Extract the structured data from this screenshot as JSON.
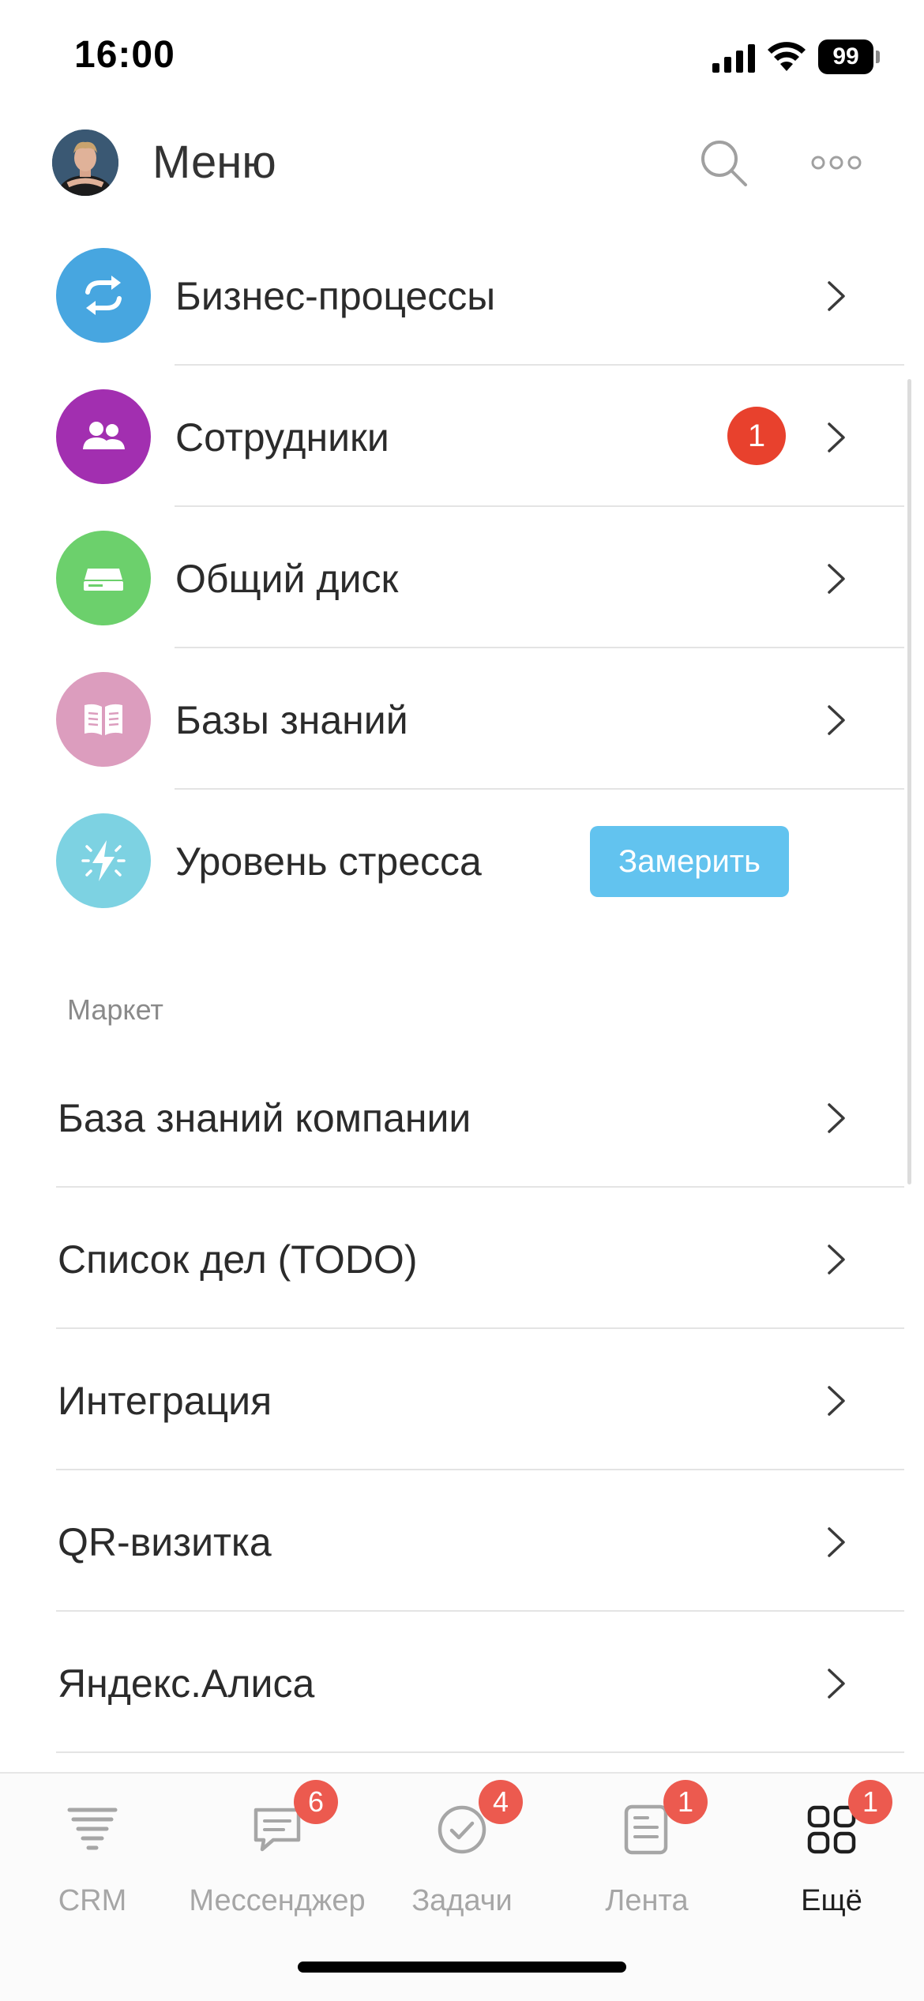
{
  "status_bar": {
    "time": "16:00",
    "battery": "99"
  },
  "header": {
    "title": "Меню",
    "icons": [
      "avatar",
      "search-icon",
      "more-icon"
    ]
  },
  "menu_items": [
    {
      "label": "Бизнес-процессы",
      "icon": "refresh-arrows-icon",
      "color": "#47a6e0"
    },
    {
      "label": "Сотрудники",
      "icon": "users-icon",
      "color": "#a22fb0",
      "badge": "1"
    },
    {
      "label": "Общий диск",
      "icon": "drive-icon",
      "color": "#6cd06c"
    },
    {
      "label": "Базы знаний",
      "icon": "book-icon",
      "color": "#dc9dbe"
    },
    {
      "label": "Уровень стресса",
      "icon": "lightning-icon",
      "color": "#7dd2e2",
      "button": "Замерить"
    }
  ],
  "market": {
    "section_title": "Маркет",
    "items": [
      "База знаний компании",
      "Список дел (TODO)",
      "Интеграция",
      "QR-визитка",
      "Яндекс.Алиса"
    ]
  },
  "tab_bar": {
    "tabs": [
      {
        "label": "CRM",
        "icon": "crm-funnel-icon",
        "badge": ""
      },
      {
        "label": "Мессенджер",
        "icon": "chat-icon",
        "badge": "6"
      },
      {
        "label": "Задачи",
        "icon": "check-circle-icon",
        "badge": "4"
      },
      {
        "label": "Лента",
        "icon": "feed-icon",
        "badge": "1"
      },
      {
        "label": "Ещё",
        "icon": "grid-icon",
        "badge": "1",
        "active": true
      }
    ]
  },
  "colors": {
    "badge_red": "#e8412d",
    "tab_badge_red": "#ec5a4f",
    "button_blue": "#62c3ef"
  }
}
